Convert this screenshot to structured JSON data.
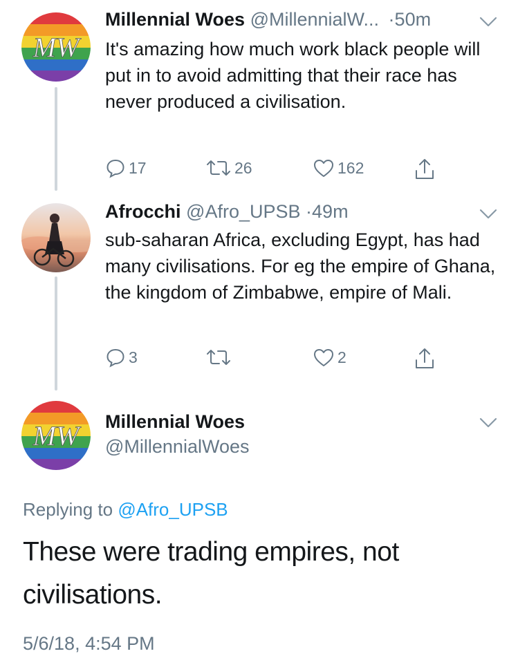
{
  "tweets": [
    {
      "name": "Millennial Woes",
      "handle": "@MillennialW...",
      "dot": "·",
      "time": "50m",
      "avatar_text": "MW",
      "text": "It's amazing how much work black people will put in to avoid admitting that their race has never produced a civilisation.",
      "replies": "17",
      "retweets": "26",
      "likes": "162"
    },
    {
      "name": "Afrocchi",
      "handle": "@Afro_UPSB",
      "dot": "·",
      "time": "49m",
      "text": "sub-saharan Africa, excluding Egypt, has had many civilisations. For eg the empire of Ghana, the kingdom of Zimbabwe, empire of Mali.",
      "replies": "3",
      "retweets": "",
      "likes": "2"
    }
  ],
  "focused": {
    "name": "Millennial Woes",
    "handle": "@MillennialWoes",
    "avatar_text": "MW",
    "replying_prefix": "Replying to",
    "replying_handle": "@Afro_UPSB",
    "text": "These were trading empires, not civilisations.",
    "timestamp": "5/6/18, 4:54 PM"
  },
  "colors": {
    "accent": "#1da1f2",
    "secondary_text": "#657786",
    "thread_line": "#cfd6dc"
  },
  "icons": [
    "reply-icon",
    "retweet-icon",
    "like-icon",
    "share-icon",
    "chevron-down-icon"
  ]
}
